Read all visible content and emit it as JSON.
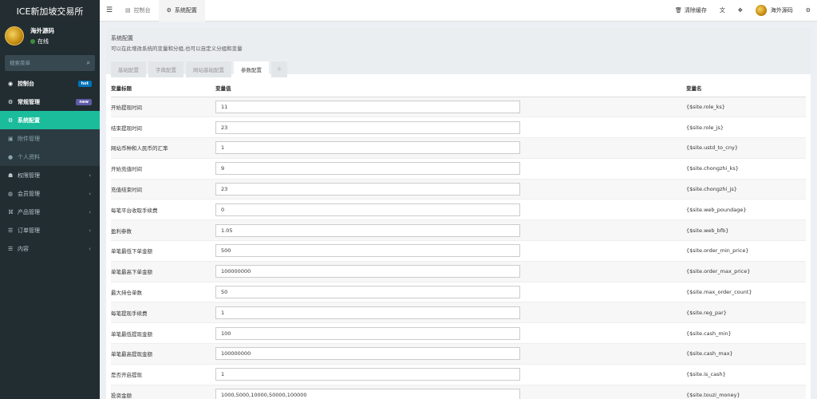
{
  "app": {
    "title": "ICE新加坡交易所"
  },
  "user": {
    "name": "海外源码",
    "status": "在线"
  },
  "sidebar": {
    "search_placeholder": "搜索菜单",
    "items": [
      {
        "label": "控制台",
        "badge": "hot"
      },
      {
        "label": "常规管理",
        "badge": "new"
      },
      {
        "label": "系统配置"
      },
      {
        "label": "附件管理"
      },
      {
        "label": "个人资料"
      },
      {
        "label": "权限管理"
      },
      {
        "label": "会员管理"
      },
      {
        "label": "产品管理"
      },
      {
        "label": "订单管理"
      },
      {
        "label": "内容"
      }
    ]
  },
  "topbar": {
    "tabs": [
      "控制台",
      "系统配置"
    ],
    "clear_cache": "清除缓存",
    "username": "海外源码"
  },
  "panel": {
    "title": "系统配置",
    "description": "可以在此增改系统的变量和分组,也可以自定义分组和变量",
    "tabs": [
      "基础配置",
      "字典配置",
      "网站基础配置",
      "参数配置"
    ],
    "add_tab": "+"
  },
  "table": {
    "headers": [
      "变量标题",
      "变量值",
      "变量名"
    ],
    "rows": [
      {
        "title": "开始提现时间",
        "value": "11",
        "name": "{$site.role_ks}"
      },
      {
        "title": "结束提现时间",
        "value": "23",
        "name": "{$site.role_js}"
      },
      {
        "title": "网站币种和人民币的汇率",
        "value": "1",
        "name": "{$site.ustd_to_cny}"
      },
      {
        "title": "开始充值时间",
        "value": "9",
        "name": "{$site.chongzhi_ks}"
      },
      {
        "title": "充值结束时间",
        "value": "23",
        "name": "{$site.chongzhi_js}"
      },
      {
        "title": "每笔平台收取手续费",
        "value": "0",
        "name": "{$site.web_poundage}"
      },
      {
        "title": "盈利参数",
        "value": "1.05",
        "name": "{$site.web_bfb}"
      },
      {
        "title": "单笔最低下单金额",
        "value": "500",
        "name": "{$site.order_min_price}"
      },
      {
        "title": "单笔最高下单金额",
        "value": "100000000",
        "name": "{$site.order_max_price}"
      },
      {
        "title": "最大持仓单数",
        "value": "50",
        "name": "{$site.max_order_count}"
      },
      {
        "title": "每笔提现手续费",
        "value": "1",
        "name": "{$site.reg_par}"
      },
      {
        "title": "单笔最低提现金额",
        "value": "100",
        "name": "{$site.cash_min}"
      },
      {
        "title": "单笔最高提现金额",
        "value": "100000000",
        "name": "{$site.cash_max}"
      },
      {
        "title": "是否开启提现",
        "value": "1",
        "name": "{$site.is_cash}"
      },
      {
        "title": "投资金额",
        "value": "1000,5000,10000,50000,100000",
        "name": "{$site.touzi_money}"
      }
    ]
  }
}
